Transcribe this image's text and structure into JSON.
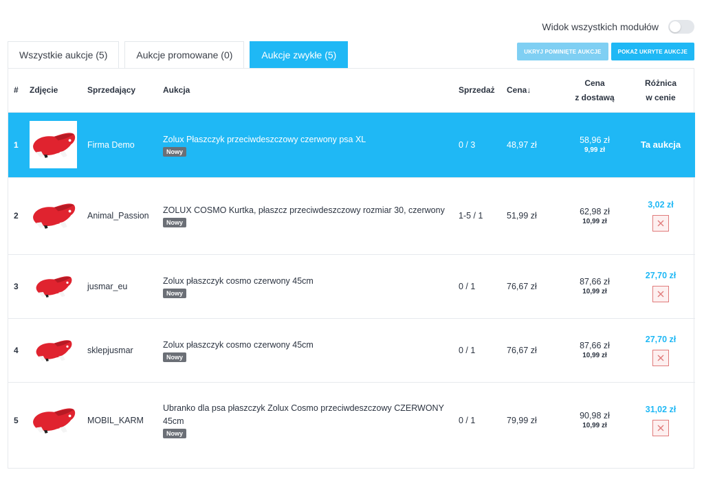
{
  "view_toggle": {
    "label": "Widok wszystkich modułów",
    "checked": false
  },
  "tabs": [
    {
      "label": "Wszystkie aukcje (5)",
      "active": false
    },
    {
      "label": "Aukcje promowane (0)",
      "active": false
    },
    {
      "label": "Aukcje zwykłe (5)",
      "active": true
    }
  ],
  "buttons": {
    "hide_skipped": "UKRYJ POMINIĘTE AUKCJE",
    "show_hidden": "POKAŻ UKRYTE AUKCJE"
  },
  "table": {
    "headers": {
      "num": "#",
      "photo": "Zdjęcie",
      "seller": "Sprzedający",
      "auction": "Aukcja",
      "sales": "Sprzedaż",
      "price": "Cena",
      "price_sort_icon": "arrow-down-icon",
      "price_shipping_line1": "Cena",
      "price_shipping_line2": "z dostawą",
      "diff_line1": "Różnica",
      "diff_line2": "w cenie"
    },
    "rows": [
      {
        "num": "1",
        "seller": "Firma Demo",
        "title": "Zolux Płaszczyk przeciwdeszczowy czerwony psa XL",
        "badge": "Nowy",
        "sales": "0 / 3",
        "price": "48,97 zł",
        "total": "58,96 zł",
        "shipping": "9,99 zł",
        "diff": "Ta aukcja",
        "highlight": true
      },
      {
        "num": "2",
        "seller": "Animal_Passion",
        "title": "ZOLUX COSMO Kurtka, płaszcz przeciwdeszczowy rozmiar 30, czerwony",
        "badge": "Nowy",
        "sales": "1-5 / 1",
        "price": "51,99 zł",
        "total": "62,98 zł",
        "shipping": "10,99 zł",
        "diff": "3,02 zł",
        "highlight": false
      },
      {
        "num": "3",
        "seller": "jusmar_eu",
        "title": "Zolux płaszczyk cosmo czerwony 45cm",
        "badge": "Nowy",
        "sales": "0 / 1",
        "price": "76,67 zł",
        "total": "87,66 zł",
        "shipping": "10,99 zł",
        "diff": "27,70 zł",
        "highlight": false
      },
      {
        "num": "4",
        "seller": "sklepjusmar",
        "title": "Zolux płaszczyk cosmo czerwony 45cm",
        "badge": "Nowy",
        "sales": "0 / 1",
        "price": "76,67 zł",
        "total": "87,66 zł",
        "shipping": "10,99 zł",
        "diff": "27,70 zł",
        "highlight": false
      },
      {
        "num": "5",
        "seller": "MOBIL_KARM",
        "title": "Ubranko dla psa płaszczyk Zolux Cosmo przeciwdeszczowy CZERWONY 45cm",
        "badge": "Nowy",
        "sales": "0 / 1",
        "price": "79,99 zł",
        "total": "90,98 zł",
        "shipping": "10,99 zł",
        "diff": "31,02 zł",
        "highlight": false
      }
    ]
  },
  "colors": {
    "accent": "#1fb8f5",
    "accent_light": "#7fcff3",
    "badge": "#6b6f76",
    "remove": "#e07a7a",
    "product": "#e0232f"
  },
  "icons": {
    "product_image": "dog-raincoat-image",
    "remove": "close-icon"
  }
}
